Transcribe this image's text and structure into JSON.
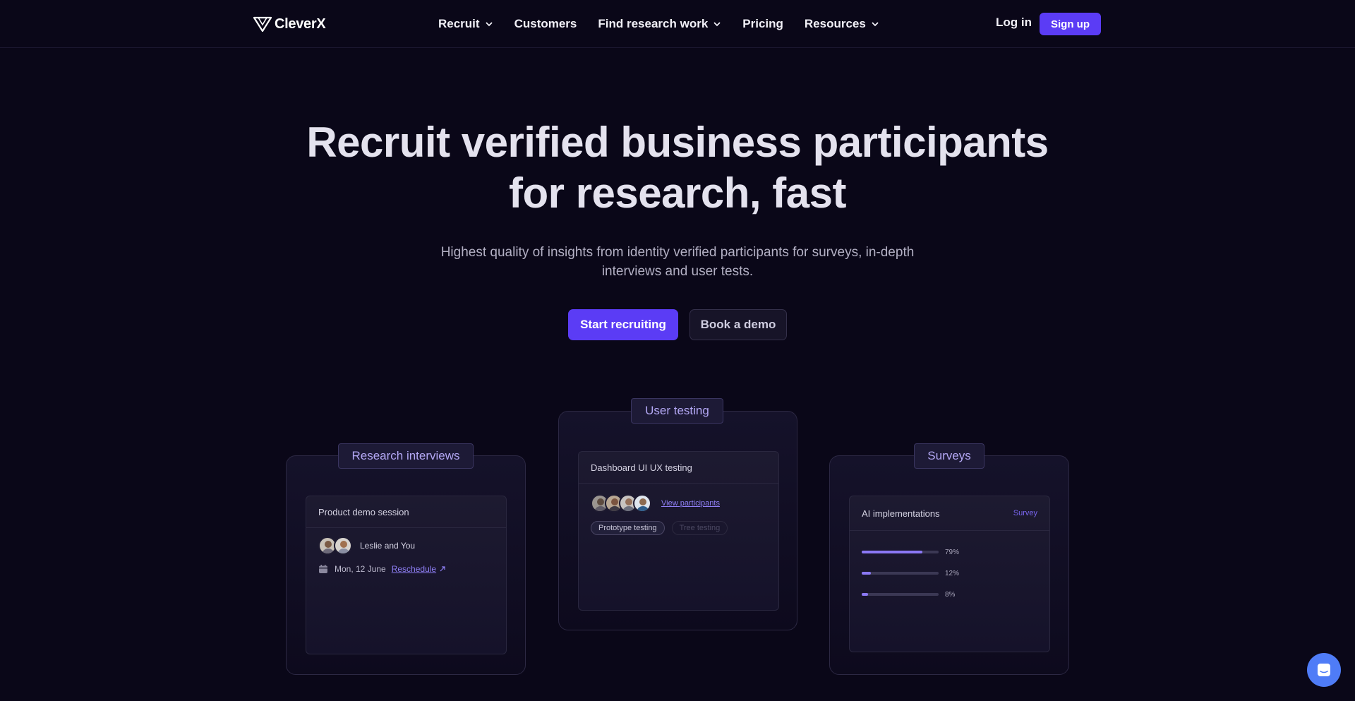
{
  "nav": {
    "logo": "CleverX",
    "items": [
      {
        "label": "Recruit",
        "has_dropdown": true
      },
      {
        "label": "Customers",
        "has_dropdown": false
      },
      {
        "label": "Find research work",
        "has_dropdown": true
      },
      {
        "label": "Pricing",
        "has_dropdown": false
      },
      {
        "label": "Resources",
        "has_dropdown": true
      }
    ],
    "login": "Log in",
    "signup": "Sign up"
  },
  "hero": {
    "headline_line1": "Recruit verified business participants",
    "headline_line2": "for research, fast",
    "subtitle": "Highest quality of insights from identity verified participants for surveys, in-depth interviews and user tests.",
    "cta_primary": "Start recruiting",
    "cta_secondary": "Book a demo"
  },
  "cards": {
    "interviews": {
      "tag": "Research interviews",
      "title": "Product demo session",
      "participants": "Leslie and You",
      "date": "Mon, 12 June",
      "reschedule": "Reschedule"
    },
    "user_testing": {
      "tag": "User testing",
      "title": "Dashboard UI UX testing",
      "view_participants": "View participants",
      "pills": [
        "Prototype testing",
        "Tree testing"
      ]
    },
    "surveys": {
      "tag": "Surveys",
      "title": "AI implementations",
      "badge": "Survey",
      "results": [
        {
          "value": 79,
          "label": "79%"
        },
        {
          "value": 12,
          "label": "12%"
        },
        {
          "value": 8,
          "label": "8%"
        }
      ]
    }
  },
  "colors": {
    "background": "#0a0718",
    "accent": "#5b3cf5",
    "tag_text": "#b4a8f5",
    "chat": "#4f7cf7"
  }
}
